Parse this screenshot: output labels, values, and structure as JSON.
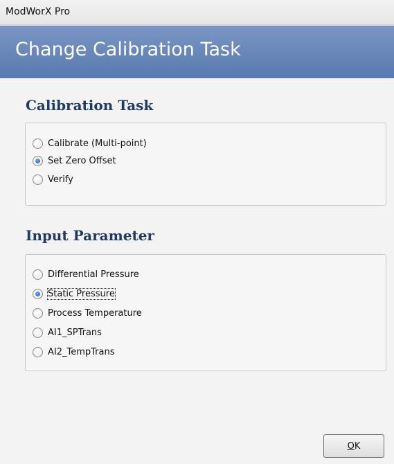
{
  "window": {
    "title": "ModWorX Pro"
  },
  "banner": {
    "heading": "Change Calibration Task"
  },
  "calibration_task": {
    "heading": "Calibration Task",
    "options": [
      {
        "label": "Calibrate (Multi-point)",
        "selected": false
      },
      {
        "label": "Set Zero Offset",
        "selected": true
      },
      {
        "label": "Verify",
        "selected": false
      }
    ]
  },
  "input_parameter": {
    "heading": "Input Parameter",
    "options": [
      {
        "label": "Differential Pressure",
        "selected": false
      },
      {
        "label": "Static Pressure",
        "selected": true
      },
      {
        "label": "Process Temperature",
        "selected": false
      },
      {
        "label": "AI1_SPTrans",
        "selected": false
      },
      {
        "label": "AI2_TempTrans",
        "selected": false
      }
    ]
  },
  "ok_button": {
    "mnemonic": "O",
    "rest": "K"
  }
}
